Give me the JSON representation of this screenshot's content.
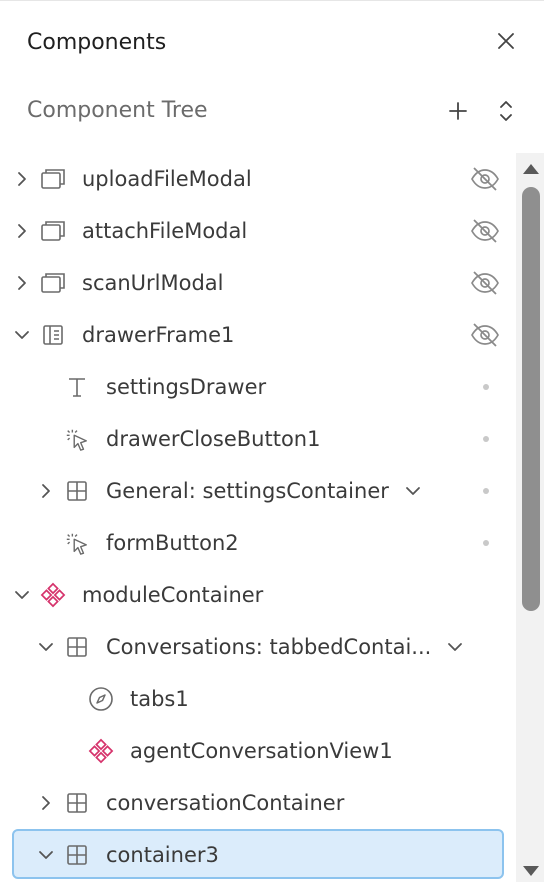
{
  "panel": {
    "title": "Components",
    "section_title": "Component Tree"
  },
  "icons": {
    "close": "close-icon",
    "add": "plus-icon",
    "sort": "expand-collapse-icon",
    "hidden": "eye-off-icon"
  },
  "colors": {
    "accent_pink": "#d6336c",
    "selection_bg": "#dbecfb",
    "selection_border": "#8cc3ee"
  },
  "tree": [
    {
      "label": "uploadFileModal",
      "indent": 0,
      "chevron": "right",
      "icon": "modal-icon",
      "status": "hidden"
    },
    {
      "label": "attachFileModal",
      "indent": 0,
      "chevron": "right",
      "icon": "modal-icon",
      "status": "hidden"
    },
    {
      "label": "scanUrlModal",
      "indent": 0,
      "chevron": "right",
      "icon": "modal-icon",
      "status": "hidden"
    },
    {
      "label": "drawerFrame1",
      "indent": 0,
      "chevron": "down",
      "icon": "drawer-icon",
      "status": "hidden"
    },
    {
      "label": "settingsDrawer",
      "indent": 1,
      "chevron": "none",
      "icon": "text-icon",
      "status": "dot"
    },
    {
      "label": "drawerCloseButton1",
      "indent": 1,
      "chevron": "none",
      "icon": "click-icon",
      "status": "dot"
    },
    {
      "label": "General: settingsContainer",
      "indent": 1,
      "chevron": "right",
      "icon": "container-icon",
      "status": "dot",
      "dropdown": true
    },
    {
      "label": "formButton2",
      "indent": 1,
      "chevron": "none",
      "icon": "click-icon",
      "status": "dot"
    },
    {
      "label": "moduleContainer",
      "indent": 0,
      "chevron": "down",
      "icon": "module-icon",
      "status": "none"
    },
    {
      "label": "Conversations: tabbedContai...",
      "indent": 1,
      "chevron": "down",
      "icon": "container-icon",
      "status": "none",
      "dropdown": true
    },
    {
      "label": "tabs1",
      "indent": 2,
      "chevron": "none",
      "icon": "compass-icon",
      "status": "none"
    },
    {
      "label": "agentConversationView1",
      "indent": 2,
      "chevron": "none",
      "icon": "module-icon",
      "status": "none"
    },
    {
      "label": "conversationContainer",
      "indent": 1,
      "chevron": "right",
      "icon": "container-icon",
      "status": "none"
    },
    {
      "label": "container3",
      "indent": 1,
      "chevron": "down",
      "icon": "container-icon",
      "status": "none",
      "selected": true
    }
  ]
}
